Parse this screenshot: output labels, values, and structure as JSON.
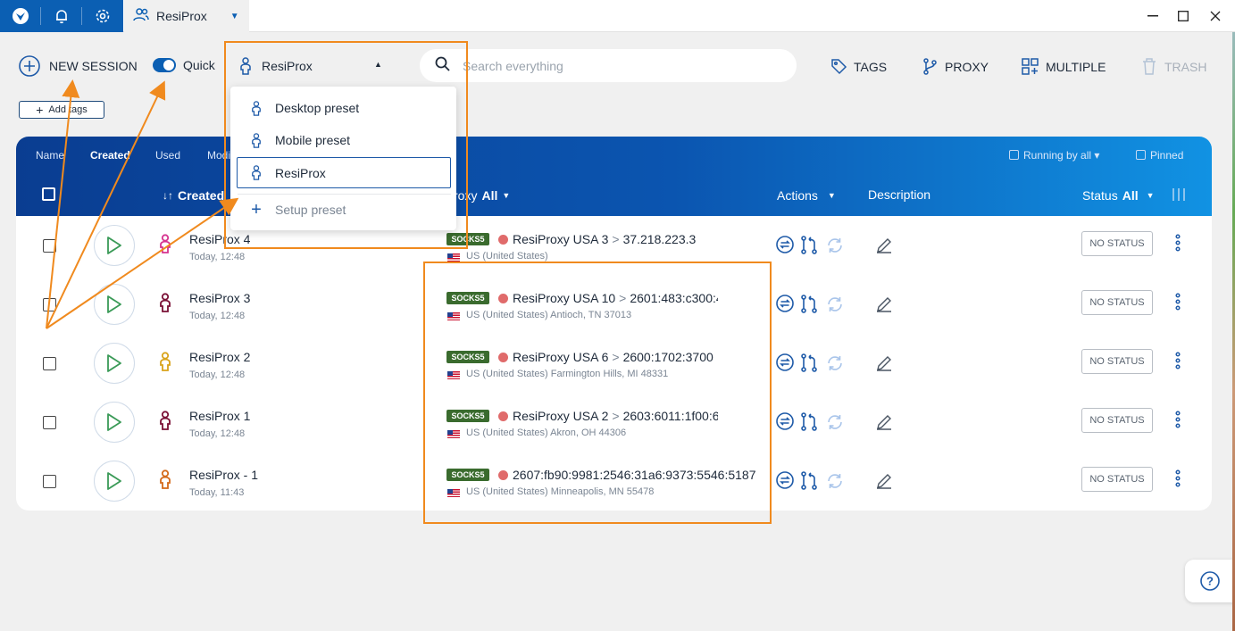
{
  "titlebar": {
    "tab_label": "ResiProx",
    "colors": {
      "brand": "#0b5fb3"
    }
  },
  "toolbar": {
    "new_session": "NEW SESSION",
    "quick": "Quick",
    "preset_selected": "ResiProx",
    "search_placeholder": "Search everything",
    "tags": "TAGS",
    "proxy": "PROXY",
    "multiple": "MULTIPLE",
    "trash": "TRASH"
  },
  "add_tags": "Add tags",
  "sort_bar": {
    "items": [
      "Name",
      "Created",
      "Used",
      "Modi"
    ],
    "running_by_all": "Running by all",
    "pinned": "Pinned"
  },
  "columns": {
    "created": "Created",
    "proxy": "roxy",
    "proxy_filter": "All",
    "actions": "Actions",
    "description": "Description",
    "status": "Status",
    "status_filter": "All"
  },
  "dropdown": {
    "items": [
      "Desktop preset",
      "Mobile preset",
      "ResiProx"
    ],
    "setup": "Setup preset"
  },
  "rows": [
    {
      "name": "ResiProx 4",
      "date": "Today, 12:48",
      "proxy_type": "SOCKS5",
      "proxy_name": "ResiProxy USA 3",
      "proxy_ip": "37.218.223.3",
      "geo": "US (United States)",
      "status": "NO STATUS",
      "icon_color": "#d6338f"
    },
    {
      "name": "ResiProx 3",
      "date": "Today, 12:48",
      "proxy_type": "SOCKS5",
      "proxy_name": "ResiProxy USA 10",
      "proxy_ip": "2601:483:c300:4",
      "geo": "US (United States) Antioch, TN 37013",
      "status": "NO STATUS",
      "icon_color": "#7a1035"
    },
    {
      "name": "ResiProx 2",
      "date": "Today, 12:48",
      "proxy_type": "SOCKS5",
      "proxy_name": "ResiProxy USA 6",
      "proxy_ip": "2600:1702:3700",
      "geo": "US (United States) Farmington Hills, MI 48331",
      "status": "NO STATUS",
      "icon_color": "#d9a31a"
    },
    {
      "name": "ResiProx 1",
      "date": "Today, 12:48",
      "proxy_type": "SOCKS5",
      "proxy_name": "ResiProxy USA 2",
      "proxy_ip": "2603:6011:1f00:6",
      "geo": "US (United States) Akron, OH 44306",
      "status": "NO STATUS",
      "icon_color": "#7a1035"
    },
    {
      "name": "ResiProx - 1",
      "date": "Today, 11:43",
      "proxy_type": "SOCKS5",
      "proxy_name": "",
      "proxy_ip": "2607:fb90:9981:2546:31a6:9373:5546:5187",
      "geo": "US (United States) Minneapolis, MN 55478",
      "status": "NO STATUS",
      "icon_color": "#d46a1a"
    }
  ],
  "colors": {
    "accent_blue": "#0b5fb3",
    "annotation_orange": "#f08a1e",
    "offline_dot": "#e06b6b",
    "socks_badge": "#3a6b2e"
  }
}
